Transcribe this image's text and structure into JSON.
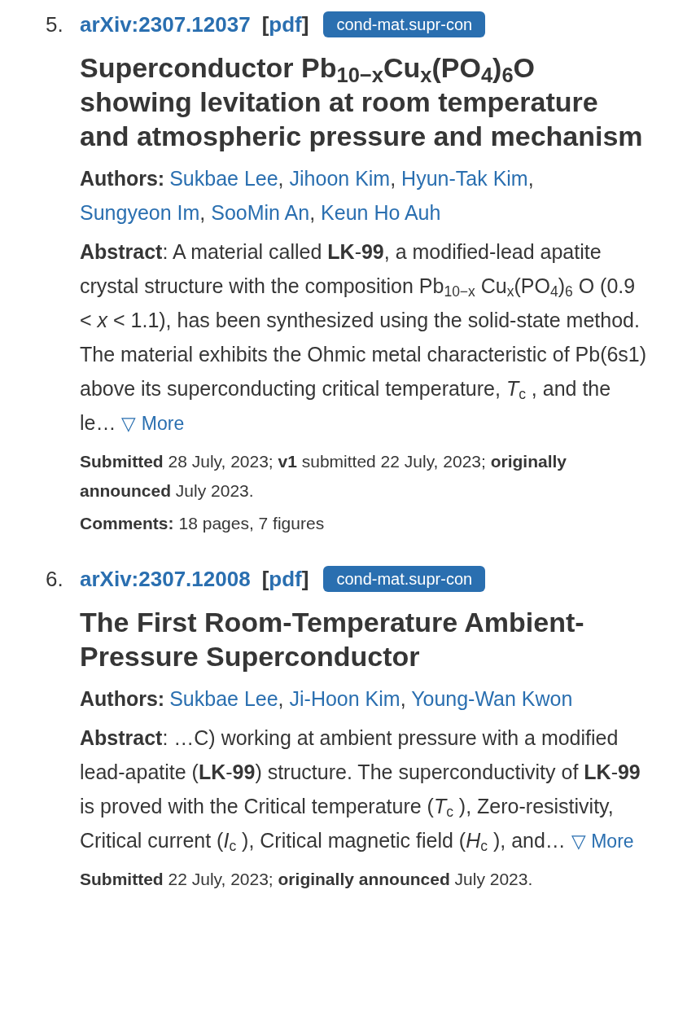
{
  "results": [
    {
      "number": "5.",
      "id": "arXiv:2307.12037",
      "bracket_open": "[",
      "pdf": "pdf",
      "bracket_close": "]",
      "tag": "cond-mat.supr-con",
      "title": "Superconductor Pb$_{10−x}$Cu$_{x}$(PO$_{4}$)$_{6}$O showing levitation at room temperature and atmospheric pressure and mechanism",
      "authors_label": "Authors:",
      "author_separator": ",",
      "authors": [
        "Sukbae Lee",
        "Jihoon Kim",
        "Hyun-Tak Kim",
        "Sungyeon Im",
        "SooMin An",
        "Keun Ho Auh"
      ],
      "abstract": "**Abstract**: A material called **LK**-**99**, a modified-lead apatite crystal structure with the composition Pb$_{10−x}$ Cu$_{x}$(PO$_{4}$)$_{6}$ O (0.9 < *x* < 1.1), has been synthesized using the solid-state method. The material exhibits the Ohmic metal characteristic of Pb(6s1) above its superconducting critical temperature, *T*$_{c}$ , and the le…",
      "more": "▽ More",
      "submitted": "**Submitted** 28 July, 2023; **v1** submitted 22 July, 2023; **originally announced** July 2023.",
      "comments_label": "Comments:",
      "comments": "18 pages, 7 figures"
    },
    {
      "number": "6.",
      "id": "arXiv:2307.12008",
      "bracket_open": "[",
      "pdf": "pdf",
      "bracket_close": "]",
      "tag": "cond-mat.supr-con",
      "title": "The First Room-Temperature Ambient-Pressure Superconductor",
      "authors_label": "Authors:",
      "author_separator": ",",
      "authors": [
        "Sukbae Lee",
        "Ji-Hoon Kim",
        "Young-Wan Kwon"
      ],
      "abstract": "**Abstract**: …C) working at ambient pressure with a modified lead-apatite (**LK**-**99**) structure. The superconductivity of **LK**-**99** is proved with the Critical temperature (*T*$_{c}$ ), Zero-resistivity, Critical current (*I*$_{c}$ ), Critical magnetic field (*H*$_{c}$ ), and…",
      "more": "▽ More",
      "submitted": "**Submitted** 22 July, 2023; **originally announced** July 2023."
    }
  ]
}
